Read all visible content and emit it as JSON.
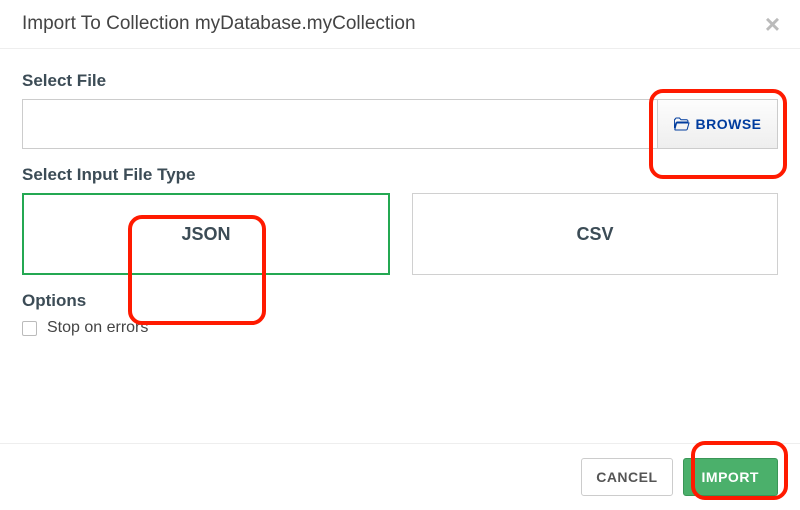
{
  "header": {
    "title": "Import To Collection myDatabase.myCollection"
  },
  "selectFile": {
    "label": "Select File",
    "value": "",
    "browse_label": "BROWSE"
  },
  "selectType": {
    "label": "Select Input File Type",
    "json_label": "JSON",
    "csv_label": "CSV"
  },
  "options": {
    "label": "Options",
    "stop_on_errors_label": "Stop on errors"
  },
  "footer": {
    "cancel_label": "CANCEL",
    "import_label": "IMPORT"
  }
}
